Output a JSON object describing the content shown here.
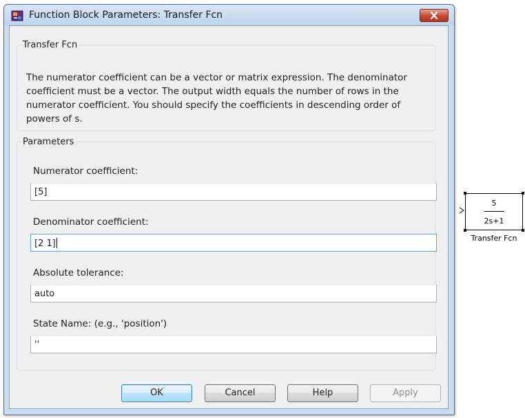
{
  "dialog": {
    "title": "Function Block Parameters: Transfer Fcn",
    "description_group_title": "Transfer Fcn",
    "description": "The numerator coefficient can be a vector or matrix expression. The denominator coefficient must be a vector. The output width equals the number of rows in the numerator coefficient. You should specify the coefficients in descending order of powers of s.",
    "parameters_group_title": "Parameters",
    "fields": {
      "numerator": {
        "label": "Numerator coefficient:",
        "value": "[5]"
      },
      "denominator": {
        "label": "Denominator coefficient:",
        "value": "[2 1]"
      },
      "abs_tolerance": {
        "label": "Absolute tolerance:",
        "value": "auto"
      },
      "state_name": {
        "label": "State Name: (e.g., 'position')",
        "value": "''"
      }
    },
    "buttons": {
      "ok": "OK",
      "cancel": "Cancel",
      "help": "Help",
      "apply": "Apply"
    }
  },
  "block": {
    "numerator": "5",
    "denominator": "2s+1",
    "name": "Transfer Fcn"
  },
  "colors": {
    "window_frame": "#c9dcf0",
    "close_button": "#c74831",
    "focus_border": "#5aa3d6"
  }
}
